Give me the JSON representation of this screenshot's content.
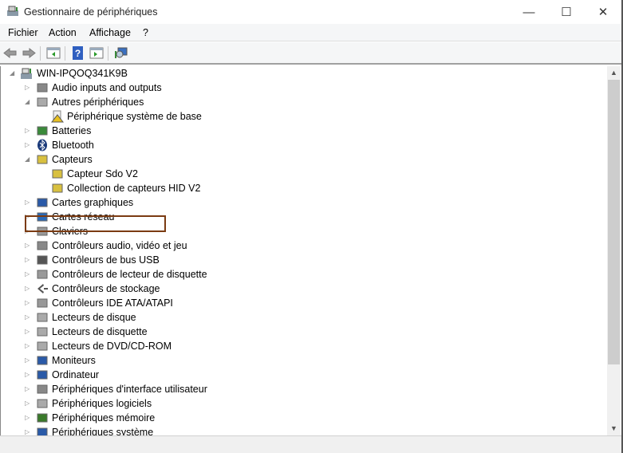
{
  "window": {
    "title": "Gestionnaire de périphériques",
    "minimize_icon": "—",
    "maximize_icon": "☐",
    "close_icon": "✕"
  },
  "menu": [
    "Fichier",
    "Action",
    "Affichage",
    "?"
  ],
  "toolbar": [
    "back-icon",
    "forward-icon",
    "show-hide-console-tree-icon",
    "help-icon",
    "properties-icon",
    "scan-hardware-icon"
  ],
  "tree": {
    "root": "WIN-IPQOQ341K9B",
    "items": [
      {
        "label": "Audio inputs and outputs",
        "level": 1,
        "expanded": false
      },
      {
        "label": "Autres périphériques",
        "level": 1,
        "expanded": true
      },
      {
        "label": "Périphérique système de base",
        "level": 2,
        "warning": true
      },
      {
        "label": "Batteries",
        "level": 1,
        "expanded": false
      },
      {
        "label": "Bluetooth",
        "level": 1,
        "expanded": false
      },
      {
        "label": "Capteurs",
        "level": 1,
        "expanded": true
      },
      {
        "label": "Capteur Sdo V2",
        "level": 2
      },
      {
        "label": "Collection de capteurs HID V2",
        "level": 2
      },
      {
        "label": "Cartes graphiques",
        "level": 1,
        "expanded": false
      },
      {
        "label": "Cartes réseau",
        "level": 1,
        "expanded": false
      },
      {
        "label": "Claviers",
        "level": 1,
        "expanded": false
      },
      {
        "label": "Contrôleurs audio, vidéo et jeu",
        "level": 1,
        "expanded": false
      },
      {
        "label": "Contrôleurs de bus USB",
        "level": 1,
        "expanded": false
      },
      {
        "label": "Contrôleurs de lecteur de disquette",
        "level": 1,
        "expanded": false
      },
      {
        "label": "Contrôleurs de stockage",
        "level": 1,
        "expanded": false,
        "highlighted": true
      },
      {
        "label": "Contrôleurs IDE ATA/ATAPI",
        "level": 1,
        "expanded": false
      },
      {
        "label": "Lecteurs de disque",
        "level": 1,
        "expanded": false
      },
      {
        "label": "Lecteurs de disquette",
        "level": 1,
        "expanded": false
      },
      {
        "label": "Lecteurs de DVD/CD-ROM",
        "level": 1,
        "expanded": false
      },
      {
        "label": "Moniteurs",
        "level": 1,
        "expanded": false
      },
      {
        "label": "Ordinateur",
        "level": 1,
        "expanded": false
      },
      {
        "label": "Périphériques d'interface utilisateur",
        "level": 1,
        "expanded": false
      },
      {
        "label": "Périphériques logiciels",
        "level": 1,
        "expanded": false
      },
      {
        "label": "Périphériques mémoire",
        "level": 1,
        "expanded": false
      },
      {
        "label": "Périphériques système",
        "level": 1,
        "expanded": false
      }
    ]
  },
  "colors": {
    "highlight_border": "#7b3b12"
  }
}
